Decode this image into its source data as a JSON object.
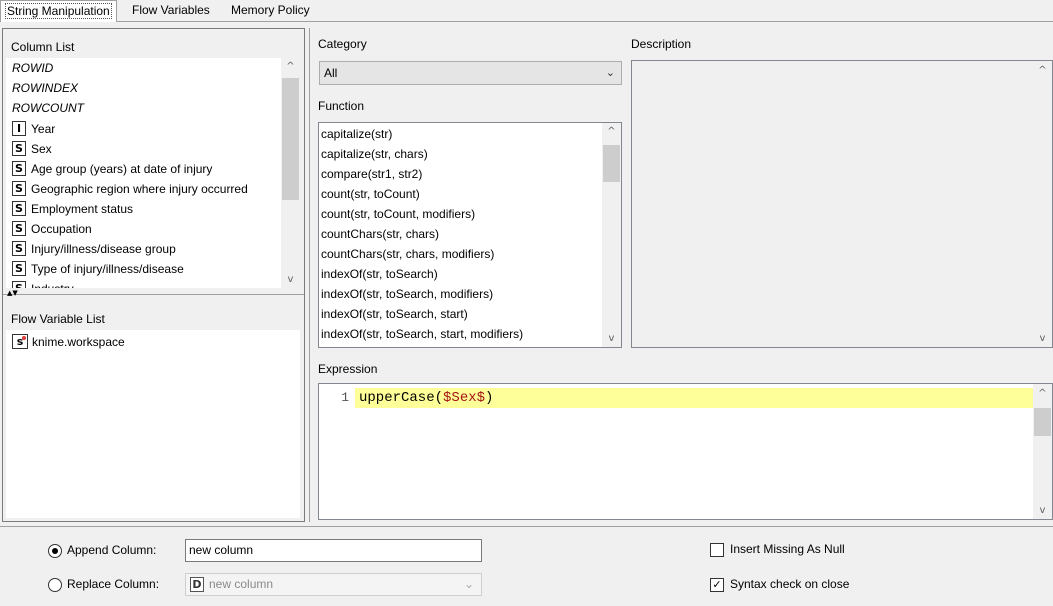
{
  "tabs": [
    {
      "label": "String Manipulation",
      "active": true
    },
    {
      "label": "Flow Variables",
      "active": false
    },
    {
      "label": "Memory Policy",
      "active": false
    }
  ],
  "column_list": {
    "label": "Column List",
    "special": [
      "ROWID",
      "ROWINDEX",
      "ROWCOUNT"
    ],
    "columns": [
      {
        "type": "I",
        "name": "Year"
      },
      {
        "type": "S",
        "name": "Sex"
      },
      {
        "type": "S",
        "name": "Age group (years) at date of injury"
      },
      {
        "type": "S",
        "name": "Geographic region where injury occurred"
      },
      {
        "type": "S",
        "name": "Employment status"
      },
      {
        "type": "S",
        "name": "Occupation"
      },
      {
        "type": "S",
        "name": "Injury/illness/disease group"
      },
      {
        "type": "S",
        "name": "Type of injury/illness/disease"
      },
      {
        "type": "S",
        "name": "Industry"
      }
    ]
  },
  "flow_variable_list": {
    "label": "Flow Variable List",
    "items": [
      {
        "type": "s",
        "name": "knime.workspace"
      }
    ]
  },
  "category": {
    "label": "Category",
    "selected": "All"
  },
  "function": {
    "label": "Function",
    "items": [
      "capitalize(str)",
      "capitalize(str, chars)",
      "compare(str1, str2)",
      "count(str, toCount)",
      "count(str, toCount, modifiers)",
      "countChars(str, chars)",
      "countChars(str, chars, modifiers)",
      "indexOf(str, toSearch)",
      "indexOf(str, toSearch, modifiers)",
      "indexOf(str, toSearch, start)",
      "indexOf(str, toSearch, start, modifiers)"
    ]
  },
  "description": {
    "label": "Description"
  },
  "expression": {
    "label": "Expression",
    "line_number": "1",
    "fn": "upperCase",
    "open": "(",
    "arg": "$Sex$",
    "close": ")"
  },
  "output": {
    "append_label": "Append Column:",
    "append_value": "new column",
    "replace_label": "Replace Column:",
    "replace_type": "D",
    "replace_value": "new column",
    "insert_missing_label": "Insert Missing As Null",
    "syntax_check_label": "Syntax check on close"
  }
}
